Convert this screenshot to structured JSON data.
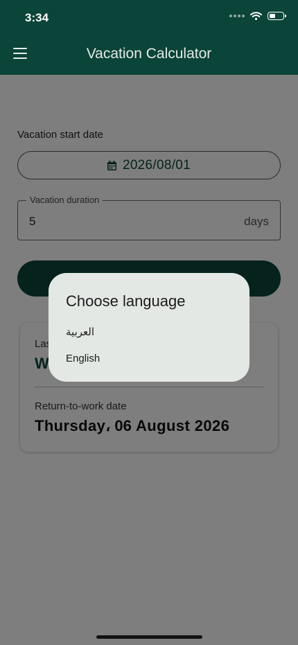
{
  "status_bar": {
    "time": "3:34"
  },
  "app_bar": {
    "title": "Vacation Calculator"
  },
  "form": {
    "start_date_label": "Vacation start date",
    "start_date_value": "2026/08/01",
    "duration_label": "Vacation duration",
    "duration_value": "5",
    "duration_suffix": "days"
  },
  "result": {
    "last_day_label": "Last",
    "last_day_value": "W",
    "return_label": "Return-to-work date",
    "return_value": "Thursday، 06 August 2026"
  },
  "dialog": {
    "title": "Choose language",
    "options": [
      "العربية",
      "English"
    ]
  },
  "colors": {
    "primary": "#0b4438",
    "dialog_bg": "#e3e8e5"
  },
  "icons": {
    "menu": "menu-icon",
    "calendar": "calendar-icon",
    "wifi": "wifi-icon",
    "battery": "battery-icon"
  }
}
